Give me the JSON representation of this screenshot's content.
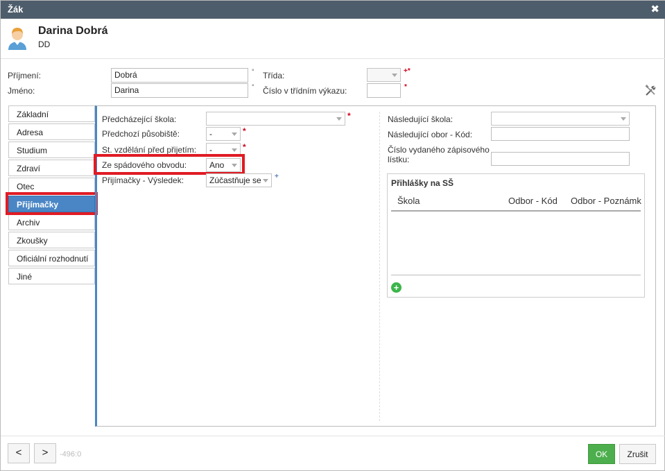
{
  "window": {
    "title": "Žák",
    "close_icon": "close-icon"
  },
  "header": {
    "name": "Darina Dobrá",
    "initials": "DD",
    "icon": "user-avatar-icon"
  },
  "top_fields": {
    "surname_label": "Příjmení:",
    "surname_value": "Dobrá",
    "firstname_label": "Jméno:",
    "firstname_value": "Darina",
    "class_label": "Třída:",
    "class_value": "",
    "class_number_label": "Číslo v třídním výkazu:",
    "class_number_value": "",
    "degree_mark": "°",
    "required_mark": "*",
    "required_class_mark": "+*",
    "tools_icon": "wrench-tools-icon"
  },
  "tabs": [
    {
      "label": "Základní"
    },
    {
      "label": "Adresa"
    },
    {
      "label": "Studium"
    },
    {
      "label": "Zdraví"
    },
    {
      "label": "Otec"
    },
    {
      "label": "Přijímačky",
      "active": true
    },
    {
      "label": "Archiv"
    },
    {
      "label": "Zkoušky"
    },
    {
      "label": "Oficiální rozhodnutí"
    },
    {
      "label": "Jiné"
    }
  ],
  "left_form": {
    "prev_school_label": "Předcházející škola:",
    "prev_school_value": "",
    "prev_workplace_label": "Předchozí působiště:",
    "prev_workplace_value": "-",
    "edu_level_label": "St. vzdělání před přijetím:",
    "edu_level_value": "-",
    "catchment_label": "Ze spádového obvodu:",
    "catchment_value": "Ano",
    "result_label": "Přijímačky - Výsledek:",
    "result_value": "Zúčastňuje se",
    "result_mark": "+"
  },
  "right_form": {
    "next_school_label": "Následující škola:",
    "next_school_value": "",
    "next_field_label": "Následující obor - Kód:",
    "next_field_value": "",
    "ticket_label_line1": "Číslo vydaného zápisového",
    "ticket_label_line2": "lístku:",
    "ticket_value": ""
  },
  "applications": {
    "title": "Přihlášky na SŠ",
    "columns": [
      "Škola",
      "Odbor - Kód",
      "Odbor - Poznámk"
    ],
    "rows": [],
    "add_icon": "plus-circle-icon"
  },
  "footer": {
    "prev": "<",
    "next": ">",
    "record": "-496:0",
    "ok": "OK",
    "cancel": "Zrušit"
  },
  "colors": {
    "accent": "#4a86c5",
    "titlebar": "#4e5d6c",
    "highlight": "#e01b24",
    "ok": "#4cae4c"
  }
}
